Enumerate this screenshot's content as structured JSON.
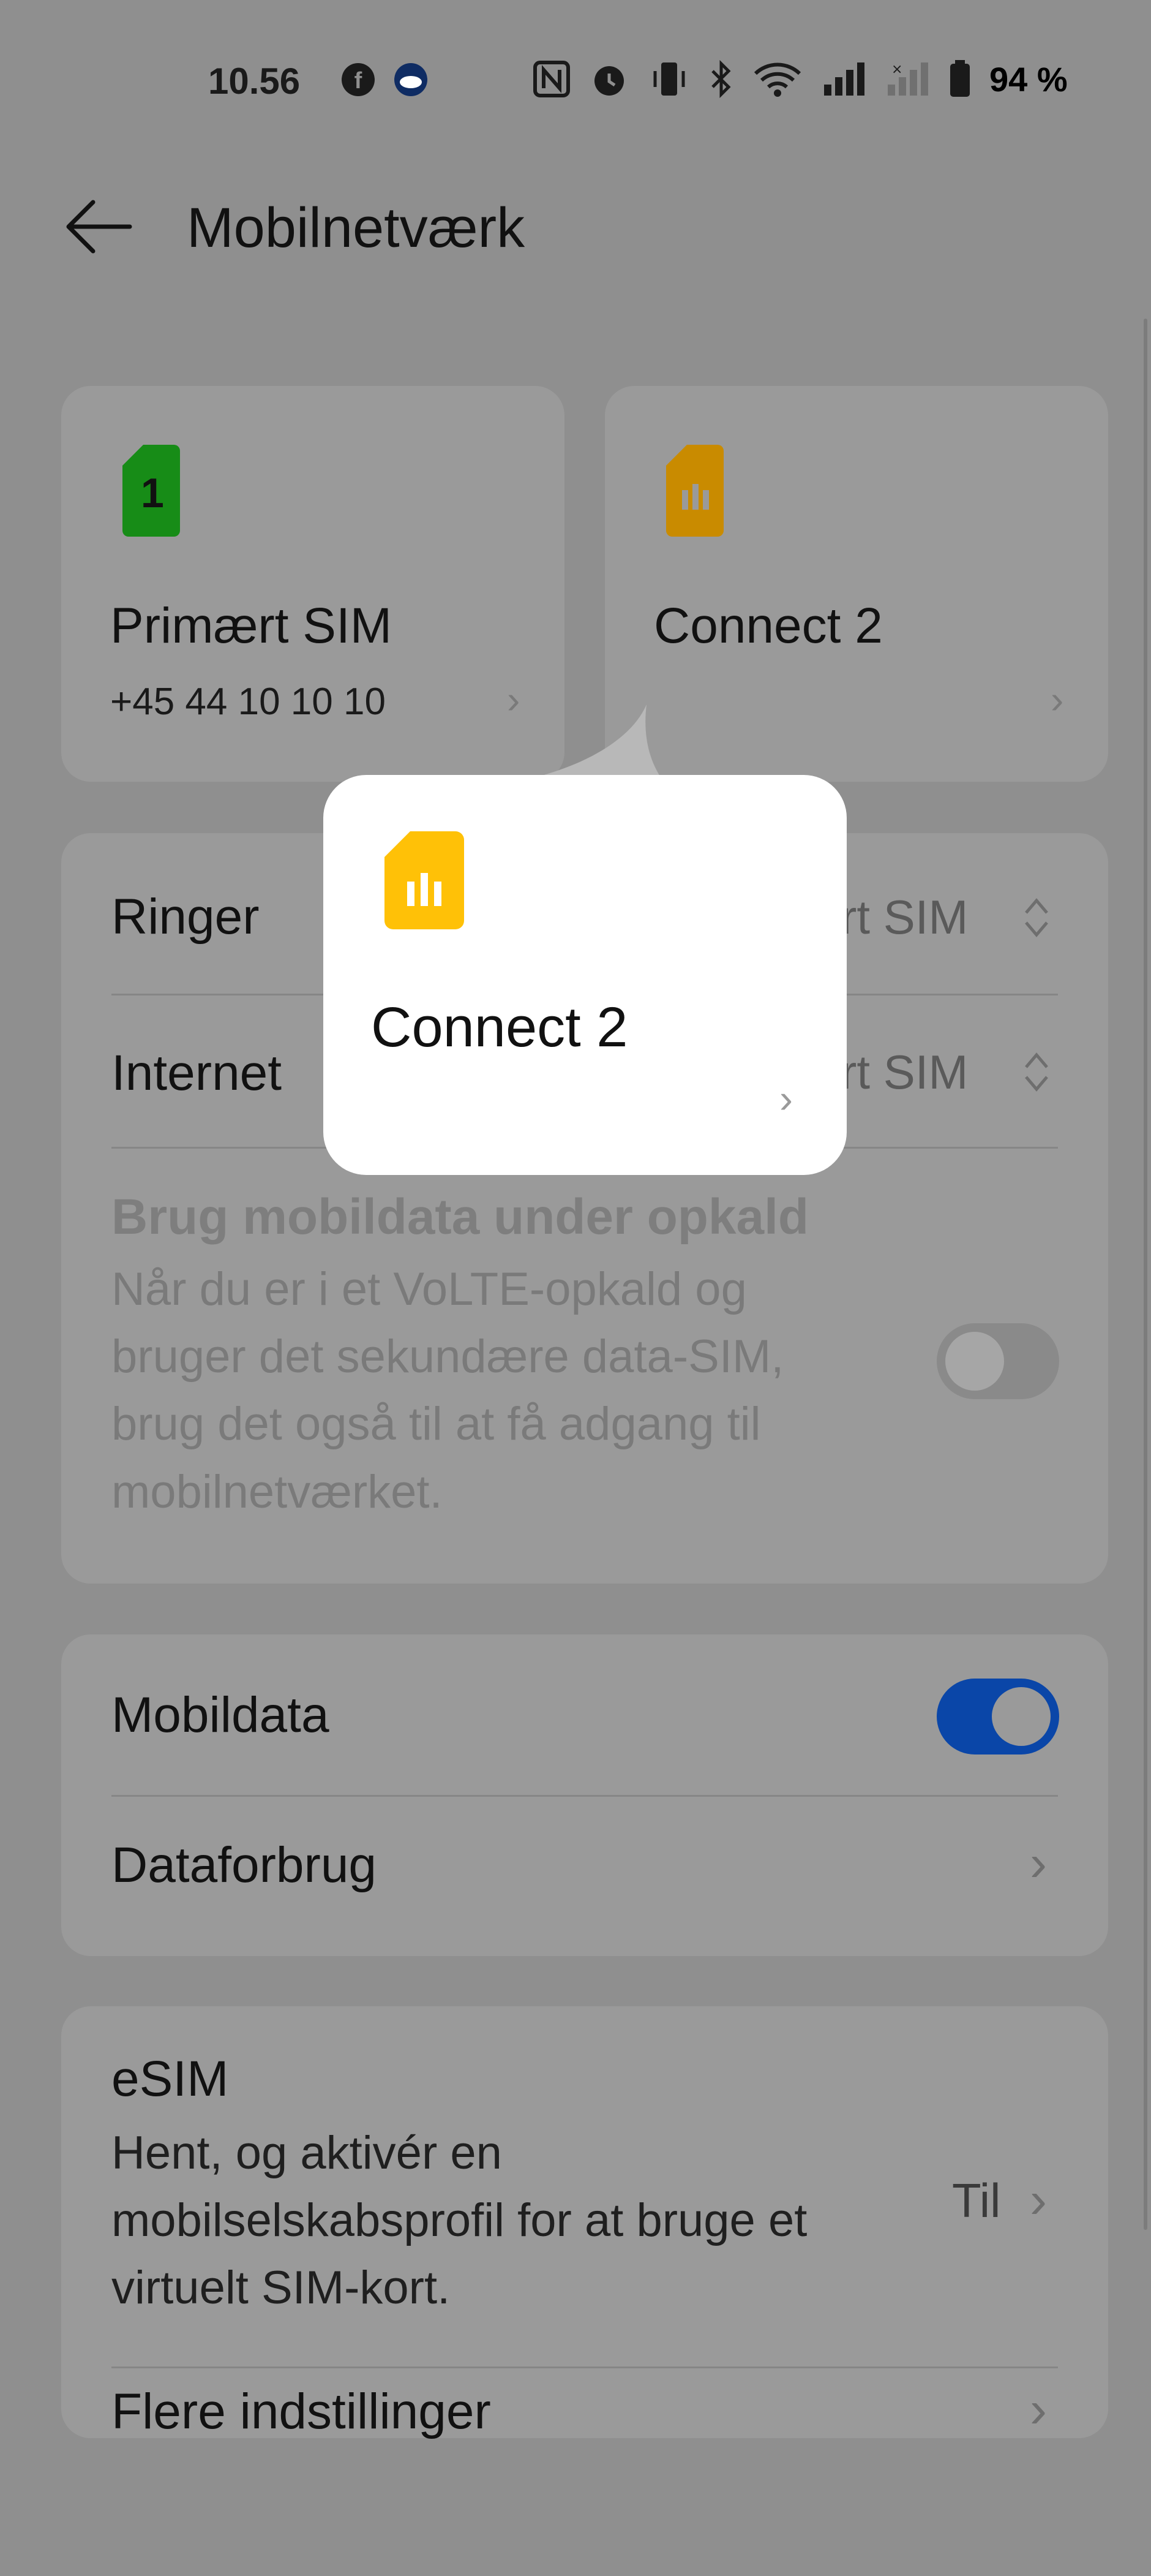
{
  "status": {
    "time": "10.56",
    "battery": "94 %",
    "icons": [
      "facebook-icon",
      "weather-icon",
      "nfc-icon",
      "alarm-icon",
      "vibrate-icon",
      "bluetooth-icon",
      "wifi-icon",
      "signal-icon",
      "signal-no-sim-icon",
      "battery-icon"
    ]
  },
  "header": {
    "title": "Mobilnetværk"
  },
  "sims": [
    {
      "badge": "1",
      "name": "Primært SIM",
      "number": "+45 44 10 10 10",
      "color": "#178c17"
    },
    {
      "badge": "",
      "name": "Connect 2",
      "number": "",
      "color": "#c98b00"
    }
  ],
  "preferences": {
    "ringer_label": "Ringer",
    "ringer_value": "ert SIM",
    "internet_label": "Internet",
    "internet_value": "ert SIM",
    "mobile_data_during_call": {
      "title": "Brug mobildata under opkald",
      "line1": "Når du er i et VoLTE-opkald og",
      "line2": "bruger det sekundære data-SIM,",
      "line3": "brug det også til at få adgang til",
      "line4": "mobilnetværket."
    }
  },
  "data_section": {
    "mobile_data_label": "Mobildata",
    "data_usage_label": "Dataforbrug"
  },
  "esim": {
    "title": "eSIM",
    "line1": "Hent, og aktivér en",
    "line2": "mobilselskabsprofil for at bruge et",
    "line3": "virtuelt SIM-kort.",
    "value": "Til",
    "more_settings": "Flere indstillinger"
  },
  "popup": {
    "name": "Connect 2"
  },
  "colors": {
    "accent": "#0a46a8",
    "sim1": "#178c17",
    "sim2": "#ffc107"
  }
}
